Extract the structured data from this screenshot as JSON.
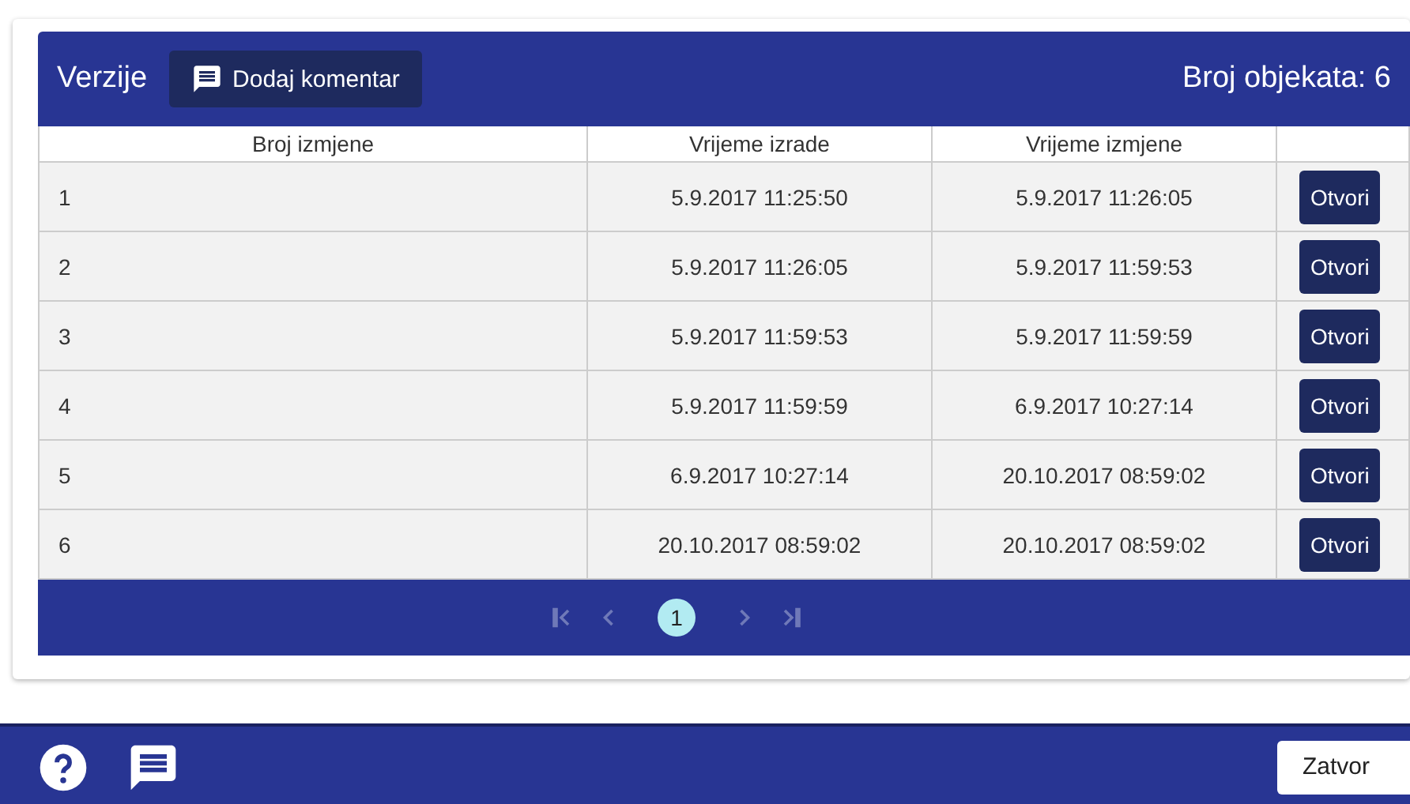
{
  "panel": {
    "title": "Verzije",
    "comment_button": "Dodaj komentar",
    "count": "Broj objekata: 6"
  },
  "table": {
    "columns": [
      "Broj izmjene",
      "Vrijeme izrade",
      "Vrijeme izmjene"
    ],
    "rows": [
      {
        "cells": [
          "1",
          "5.9.2017 11:25:50",
          "5.9.2017 11:26:05"
        ],
        "action": "Otvori"
      },
      {
        "cells": [
          "2",
          "5.9.2017 11:26:05",
          "5.9.2017 11:59:53"
        ],
        "action": "Otvori"
      },
      {
        "cells": [
          "3",
          "5.9.2017 11:59:53",
          "5.9.2017 11:59:59"
        ],
        "action": "Otvori"
      },
      {
        "cells": [
          "4",
          "5.9.2017 11:59:59",
          "6.9.2017 10:27:14"
        ],
        "action": "Otvori"
      },
      {
        "cells": [
          "5",
          "6.9.2017 10:27:14",
          "20.10.2017 08:59:02"
        ],
        "action": "Otvori"
      },
      {
        "cells": [
          "6",
          "20.10.2017 08:59:02",
          "20.10.2017 08:59:02"
        ],
        "action": "Otvori"
      }
    ]
  },
  "pagination": {
    "first_disabled": true,
    "prev_disabled": true,
    "pages": [
      {
        "label": "1",
        "selected": true
      }
    ],
    "next_disabled": true,
    "last_disabled": true
  },
  "footer": {
    "close_button": "Zatvor"
  }
}
